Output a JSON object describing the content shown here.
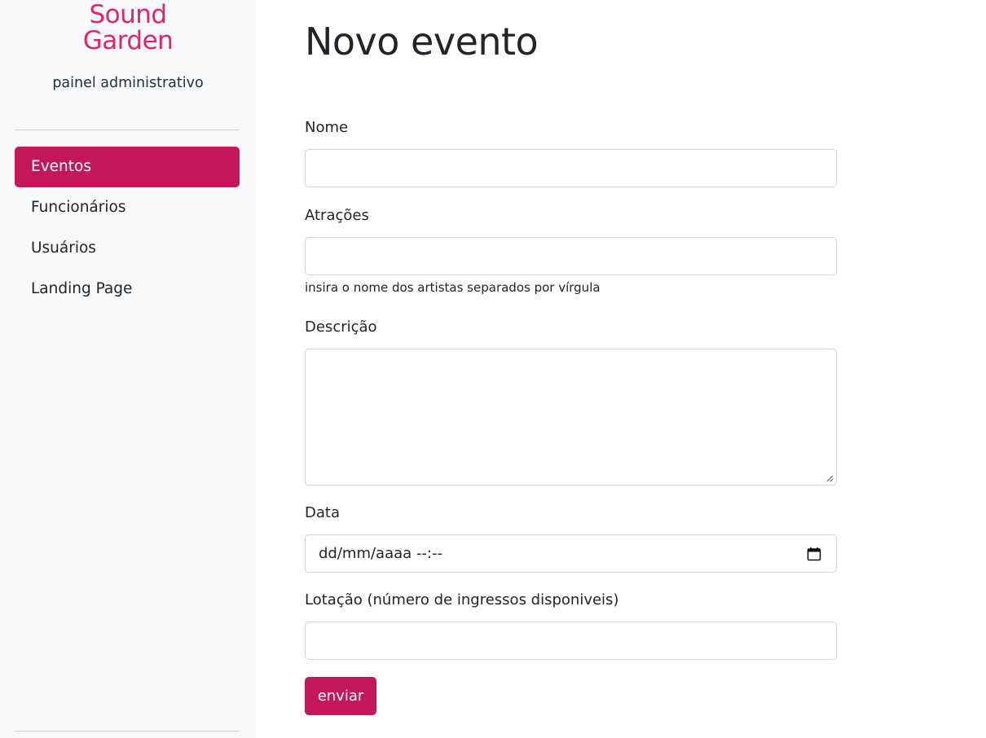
{
  "sidebar": {
    "logo_line1": "Sound",
    "logo_line2": "Garden",
    "subtitle": "painel administrativo",
    "items": [
      {
        "label": "Eventos",
        "active": true
      },
      {
        "label": "Funcionários",
        "active": false
      },
      {
        "label": "Usuários",
        "active": false
      },
      {
        "label": "Landing Page",
        "active": false
      }
    ]
  },
  "main": {
    "title": "Novo evento",
    "form": {
      "nome_label": "Nome",
      "nome_value": "",
      "atracoes_label": "Atrações",
      "atracoes_value": "",
      "atracoes_help": "insira o nome dos artistas separados por vírgula",
      "descricao_label": "Descrição",
      "data_label": "Data",
      "data_placeholder": "dd/mm/aaaa --:--",
      "lotacao_label": "Lotação (número de ingressos disponiveis)",
      "lotacao_value": "",
      "submit_label": "enviar"
    }
  },
  "colors": {
    "brand": "#e3246c",
    "accent": "#c2185b",
    "sidebar_bg": "#f8f9fa"
  },
  "icons": {
    "calendar": "calendar-icon",
    "resize": "resize-handle-icon"
  }
}
